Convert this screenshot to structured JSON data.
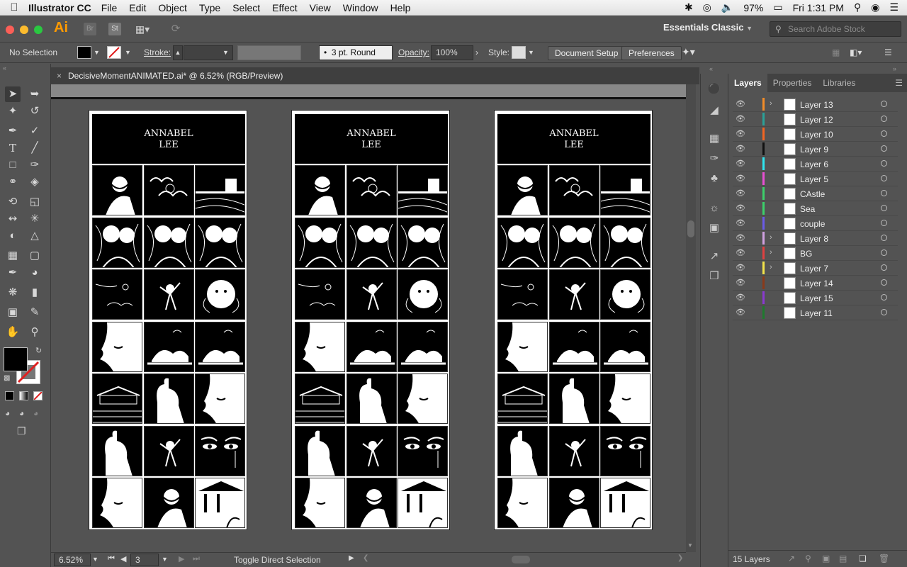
{
  "menubar": {
    "app_name": "Illustrator CC",
    "items": [
      "File",
      "Edit",
      "Object",
      "Type",
      "Select",
      "Effect",
      "View",
      "Window",
      "Help"
    ],
    "battery": "97%",
    "clock": "Fri 1:31 PM"
  },
  "appbar": {
    "logo": "Ai",
    "bridge": "Br",
    "stock_btn": "St",
    "workspace": "Essentials Classic",
    "search_placeholder": "Search Adobe Stock"
  },
  "control": {
    "selection": "No Selection",
    "stroke_label": "Stroke:",
    "brush": "3 pt. Round",
    "opacity_label": "Opacity:",
    "opacity_value": "100%",
    "style_label": "Style:",
    "document_setup": "Document Setup",
    "preferences": "Preferences"
  },
  "document": {
    "tab_title": "DecisiveMomentANIMATED.ai* @ 6.52% (RGB/Preview)",
    "poster_title_1": "ANNABEL",
    "poster_title_2": "LEE"
  },
  "status": {
    "zoom": "6.52%",
    "artboard": "3",
    "message": "Toggle Direct Selection"
  },
  "layers_panel": {
    "tabs": [
      "Layers",
      "Properties",
      "Libraries"
    ],
    "layers": [
      {
        "name": "Layer 13",
        "color": "#f28c28",
        "expandable": true
      },
      {
        "name": "Layer 12",
        "color": "#2aa198",
        "expandable": false
      },
      {
        "name": "Layer 10",
        "color": "#f26522",
        "expandable": false
      },
      {
        "name": "Layer 9",
        "color": "#111111",
        "expandable": false
      },
      {
        "name": "Layer 6",
        "color": "#2ee6f0",
        "expandable": false
      },
      {
        "name": "Layer 5",
        "color": "#e84fd3",
        "expandable": false
      },
      {
        "name": "CAstle",
        "color": "#3cd06a",
        "expandable": false
      },
      {
        "name": "Sea",
        "color": "#3cd06a",
        "expandable": false
      },
      {
        "name": "couple",
        "color": "#6a5be8",
        "expandable": false
      },
      {
        "name": "Layer 8",
        "color": "#cfa0e0",
        "expandable": true
      },
      {
        "name": "BG",
        "color": "#e04040",
        "expandable": true
      },
      {
        "name": "Layer 7",
        "color": "#f2e34a",
        "expandable": true
      },
      {
        "name": "Layer 14",
        "color": "#8a3a1a",
        "expandable": false
      },
      {
        "name": "Layer 15",
        "color": "#8a3ad0",
        "expandable": false
      },
      {
        "name": "Layer 11",
        "color": "#1e7a2e",
        "expandable": false
      }
    ],
    "footer": "15 Layers"
  }
}
